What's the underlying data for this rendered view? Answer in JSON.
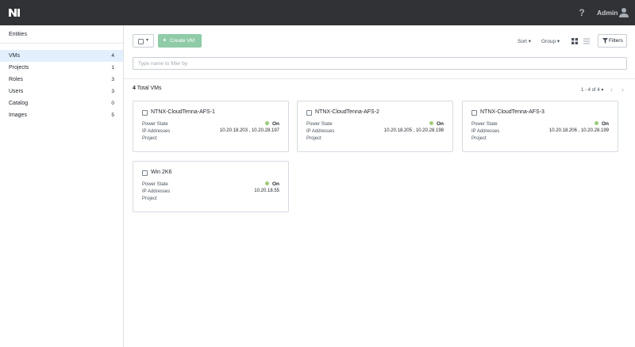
{
  "topbar": {
    "brand": "Nutanix",
    "user_label": "Admin"
  },
  "sidebar": {
    "header": "Entities",
    "items": [
      {
        "label": "VMs",
        "count": "4"
      },
      {
        "label": "Projects",
        "count": "1"
      },
      {
        "label": "Roles",
        "count": "3"
      },
      {
        "label": "Users",
        "count": "3"
      },
      {
        "label": "Catalog",
        "count": "0"
      },
      {
        "label": "Images",
        "count": "5"
      }
    ]
  },
  "toolbar": {
    "create_label": "Create VM",
    "sort_label": "Sort",
    "group_label": "Group",
    "filters_label": "Filters",
    "filter_placeholder": "Type name to filter by"
  },
  "results": {
    "total_count": "4",
    "total_suffix": "Total VMs",
    "pager": "1 - 4 of 4"
  },
  "labels": {
    "power_state": "Power State",
    "ip_addresses": "IP Addresses",
    "project": "Project"
  },
  "vms": [
    {
      "name": "NTNX-CloudTenna-AFS-1",
      "power": "On",
      "ips": "10.20.18.203 , 10.20.28.197"
    },
    {
      "name": "NTNX-CloudTenna-AFS-2",
      "power": "On",
      "ips": "10.20.18.205 , 10.20.28.198"
    },
    {
      "name": "NTNX-CloudTenna-AFS-3",
      "power": "On",
      "ips": "10.20.18.206 , 10.20.28.199"
    },
    {
      "name": "Win 2K6",
      "power": "On",
      "ips": "10.20.18.55"
    }
  ],
  "colors": {
    "topbar": "#313235",
    "active_row": "#e1f0fc",
    "create_button": "#8fcba7",
    "power_on": "#9ecb79"
  }
}
